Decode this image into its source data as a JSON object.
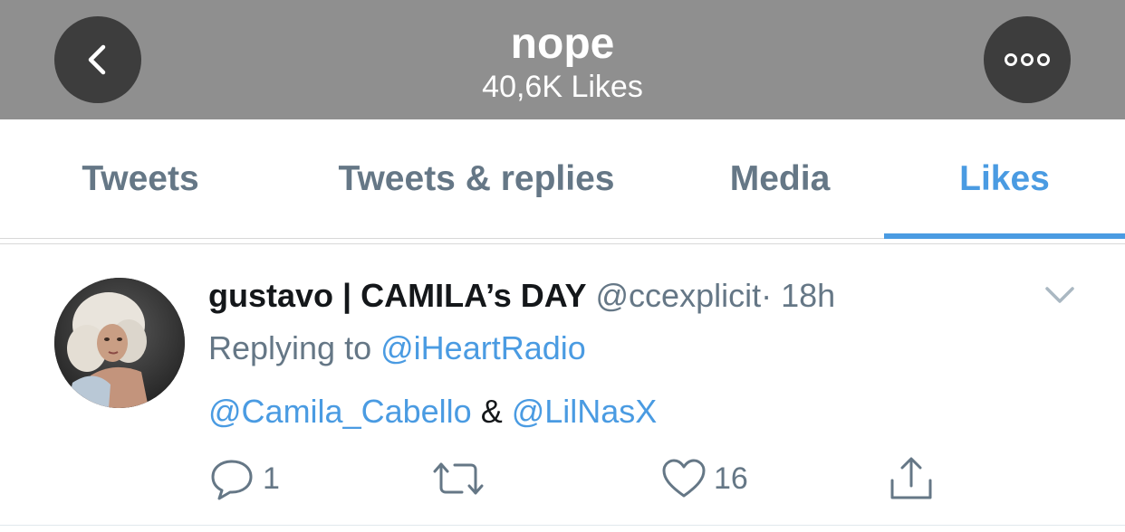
{
  "header": {
    "title": "nope",
    "subtitle": "40,6K Likes",
    "back_icon": "chevron-left-icon",
    "more_icon": "more-dots-icon",
    "background_color": "#8f8f8f"
  },
  "tabs": [
    {
      "label": "Tweets",
      "active": false
    },
    {
      "label": "Tweets & replies",
      "active": false
    },
    {
      "label": "Media",
      "active": false
    },
    {
      "label": "Likes",
      "active": true
    }
  ],
  "accent_color": "#4a9be2",
  "tweet": {
    "display_name": "gustavo | CAMILA’s DAY",
    "handle": "@ccexplicit",
    "separator": "·",
    "time": "18h",
    "replying_prefix": "Replying to",
    "replying_to": "@iHeartRadio",
    "mention_1": "@Camila_Cabello",
    "mention_joiner": "&",
    "mention_2": "@LilNasX",
    "actions": {
      "reply_count": "1",
      "retweet_count": "",
      "like_count": "16"
    }
  }
}
